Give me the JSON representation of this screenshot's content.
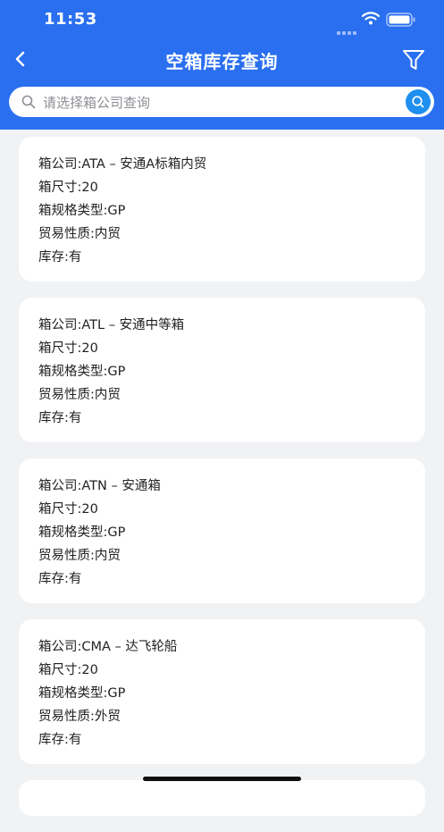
{
  "status_bar": {
    "time": "11:53"
  },
  "nav": {
    "title": "空箱库存查询"
  },
  "search": {
    "placeholder": "请选择箱公司查询"
  },
  "cards": [
    {
      "company": "箱公司:ATA – 安通A标箱内贸",
      "size": "箱尺寸:20",
      "type": "箱规格类型:GP",
      "trade": "贸易性质:内贸",
      "stock": "库存:有"
    },
    {
      "company": "箱公司:ATL – 安通中等箱",
      "size": "箱尺寸:20",
      "type": "箱规格类型:GP",
      "trade": "贸易性质:内贸",
      "stock": "库存:有"
    },
    {
      "company": "箱公司:ATN – 安通箱",
      "size": "箱尺寸:20",
      "type": "箱规格类型:GP",
      "trade": "贸易性质:内贸",
      "stock": "库存:有"
    },
    {
      "company": "箱公司:CMA – 达飞轮船",
      "size": "箱尺寸:20",
      "type": "箱规格类型:GP",
      "trade": "贸易性质:外贸",
      "stock": "库存:有"
    }
  ],
  "icons": {
    "back": "chevron-left-icon",
    "filter": "funnel-icon",
    "search": "magnifier-icon"
  },
  "colors": {
    "header": "#2a6ff0",
    "search_button": "#1f8ff0",
    "background": "#f1f2f4"
  }
}
